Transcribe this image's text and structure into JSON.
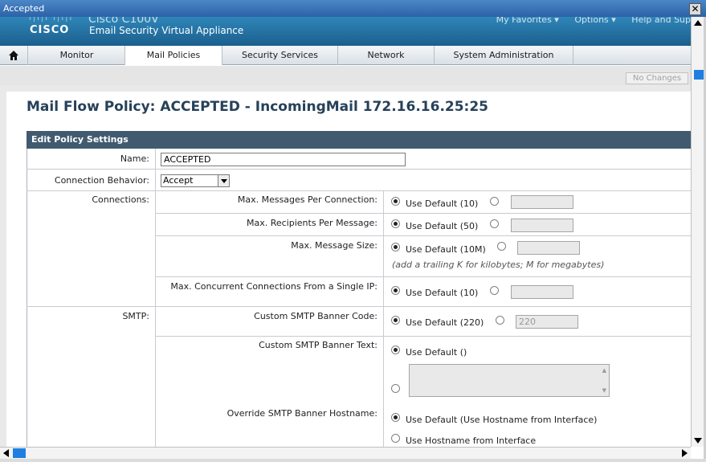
{
  "window": {
    "title": "Accepted",
    "close_symbol": "✕"
  },
  "header": {
    "logo": "CISCO",
    "product_name": "Cisco C100V",
    "subtitle": "Email Security Virtual Appliance",
    "links": [
      "My Favorites ▾",
      "Options ▾",
      "Help and Sup"
    ]
  },
  "nav": {
    "tabs": [
      "Monitor",
      "Mail Policies",
      "Security Services",
      "Network",
      "System Administration"
    ],
    "active": "Mail Policies"
  },
  "toolbar": {
    "no_changes_label": "No Changes"
  },
  "page": {
    "title": "Mail Flow Policy: ACCEPTED - IncomingMail 172.16.16.25:25"
  },
  "section": {
    "header": "Edit Policy Settings"
  },
  "form": {
    "name_label": "Name:",
    "name_value": "ACCEPTED",
    "behavior_label": "Connection Behavior:",
    "behavior_value": "Accept",
    "connections_label": "Connections:",
    "max_messages_label": "Max. Messages Per Connection:",
    "max_messages_default": "Use Default (10)",
    "max_recipients_label": "Max. Recipients Per Message:",
    "max_recipients_default": "Use Default (50)",
    "max_size_label": "Max. Message Size:",
    "max_size_default": "Use Default (10M)",
    "max_size_hint": "(add a trailing K for kilobytes; M for megabytes)",
    "max_concurrent_label": "Max. Concurrent Connections From a Single IP:",
    "max_concurrent_default": "Use Default (10)",
    "smtp_label": "SMTP:",
    "banner_code_label": "Custom SMTP Banner Code:",
    "banner_code_default": "Use Default (220)",
    "banner_code_value": "220",
    "banner_text_label": "Custom SMTP Banner Text:",
    "banner_text_default": "Use Default ()",
    "override_host_label": "Override SMTP Banner Hostname:",
    "override_host_default": "Use Default (Use Hostname from Interface)",
    "override_host_option2": "Use Hostname from Interface"
  },
  "colors": {
    "header_bg": "#1b5f8d",
    "section_header": "#415a70",
    "title_text": "#26415a"
  }
}
